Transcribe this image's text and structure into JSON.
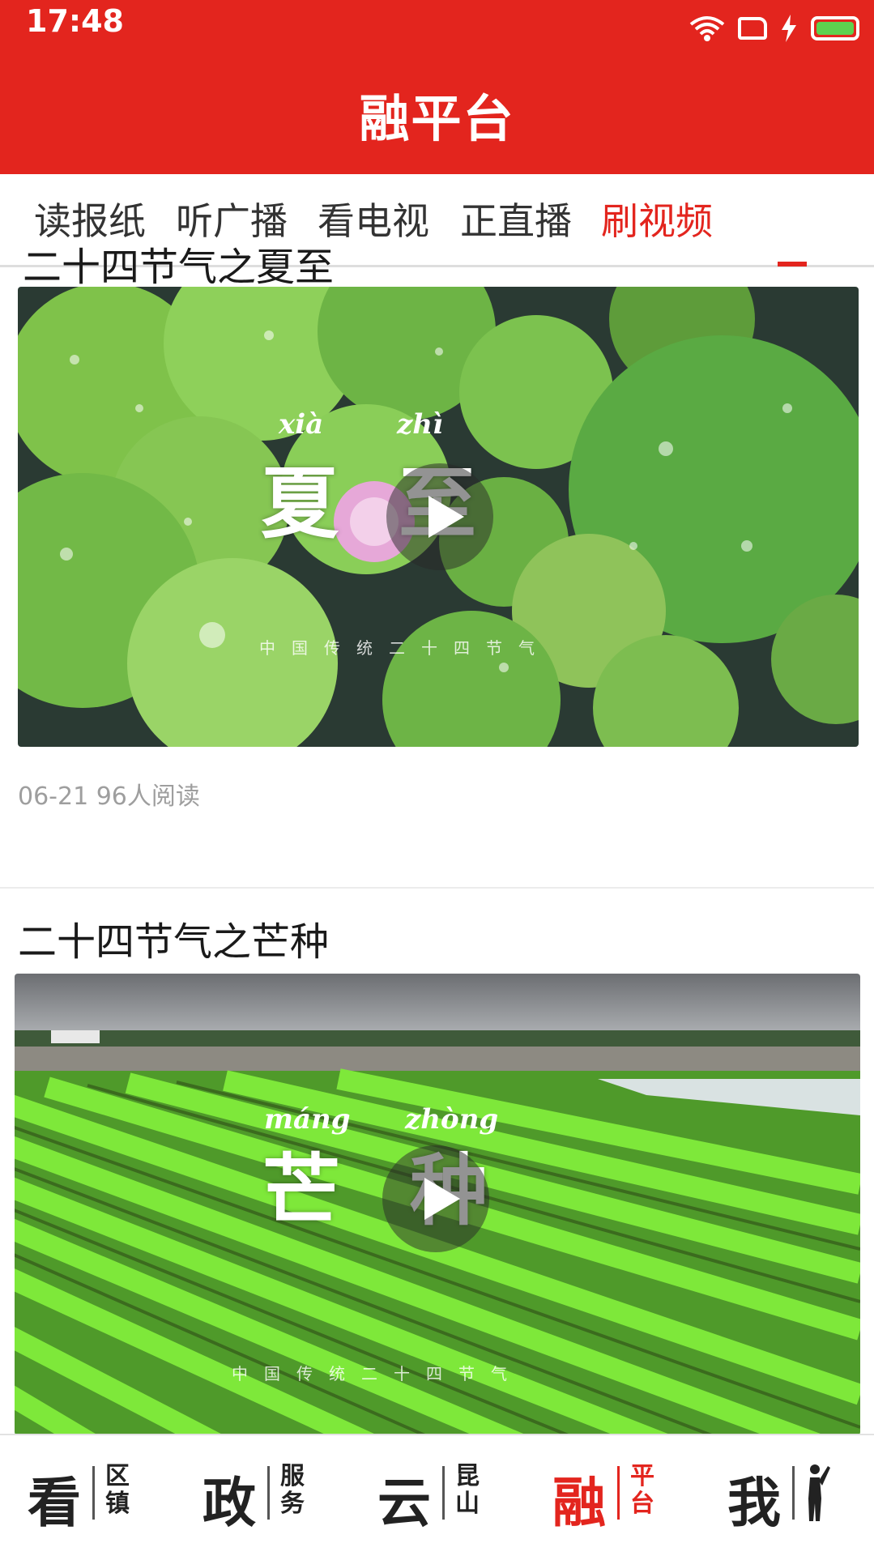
{
  "status_bar": {
    "time": "17:48",
    "battery_color": "#5dd14f"
  },
  "header": {
    "title": "融平台",
    "background": "#e3251e"
  },
  "tabs": [
    {
      "label": "读报纸",
      "active": false
    },
    {
      "label": "听广播",
      "active": false
    },
    {
      "label": "看电视",
      "active": false
    },
    {
      "label": "正直播",
      "active": false
    },
    {
      "label": "刷视频",
      "active": true
    }
  ],
  "feed": [
    {
      "title": "二十四节气之夏至",
      "meta": "06-21 96人阅读",
      "overlay": {
        "pinyin_left": "xià",
        "pinyin_right": "zhì",
        "left": "夏",
        "right": "至",
        "subtitle": "中国传统二十四节气"
      }
    },
    {
      "title": "二十四节气之芒种",
      "overlay": {
        "pinyin_left": "máng",
        "pinyin_right": "zhòng",
        "left": "芒",
        "right": "种",
        "subtitle": "中国传统二十四节气"
      }
    }
  ],
  "bottom_nav": [
    {
      "big": "看",
      "small": "区镇",
      "active": false
    },
    {
      "big": "政",
      "small": "服务",
      "active": false
    },
    {
      "big": "云",
      "small": "昆山",
      "active": false
    },
    {
      "big": "融",
      "small": "平台",
      "active": true
    },
    {
      "big": "我",
      "small": "",
      "active": false
    }
  ],
  "colors": {
    "accent": "#e3251e",
    "meta_text": "#9e9e9e"
  }
}
